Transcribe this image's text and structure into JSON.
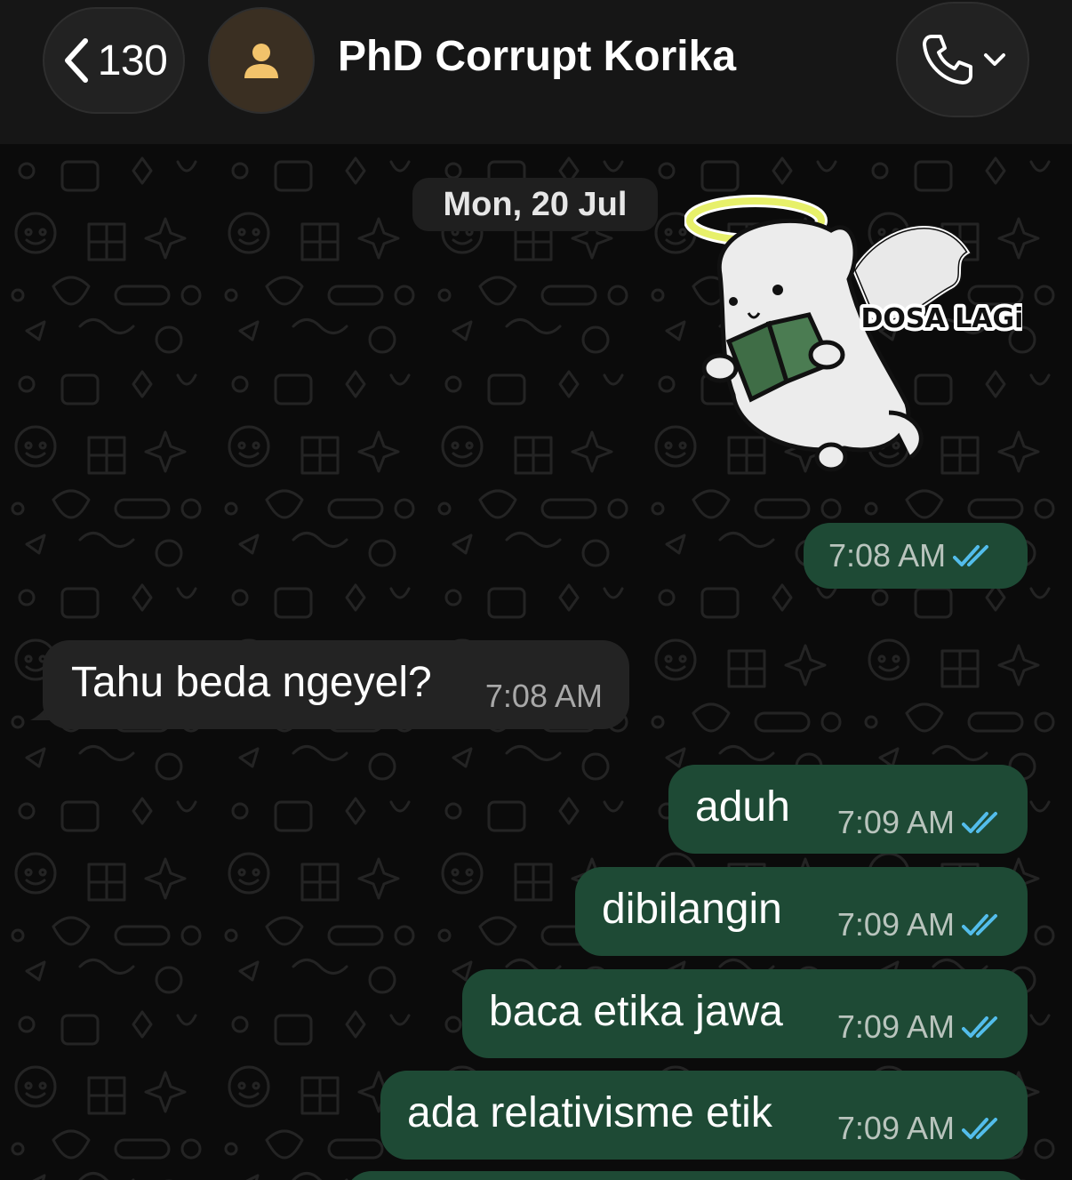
{
  "header": {
    "back_count": "130",
    "contact_name": "PhD Corrupt Korika"
  },
  "chat": {
    "date_chip": "Mon, 20 Jul",
    "sticker": {
      "caption": "DOSA LAGi"
    },
    "messages": [
      {
        "direction": "out",
        "type": "sticker",
        "time": "7:08 AM",
        "status": "read"
      },
      {
        "direction": "in",
        "text": "Tahu beda ngeyel?",
        "time": "7:08 AM"
      },
      {
        "direction": "out",
        "text": "aduh",
        "time": "7:09 AM",
        "status": "read"
      },
      {
        "direction": "out",
        "text": "dibilangin",
        "time": "7:09 AM",
        "status": "read"
      },
      {
        "direction": "out",
        "text": "baca etika jawa",
        "time": "7:09 AM",
        "status": "read"
      },
      {
        "direction": "out",
        "text": "ada relativisme etik",
        "time": "7:09 AM",
        "status": "read"
      }
    ]
  },
  "colors": {
    "outgoing_bubble": "#1e4a35",
    "incoming_bubble": "#232323",
    "read_ticks": "#53bdeb",
    "avatar_icon": "#f2c36b"
  },
  "icons": [
    "chevron-left-icon",
    "person-icon",
    "phone-icon",
    "chevron-down-icon",
    "double-check-icon"
  ]
}
